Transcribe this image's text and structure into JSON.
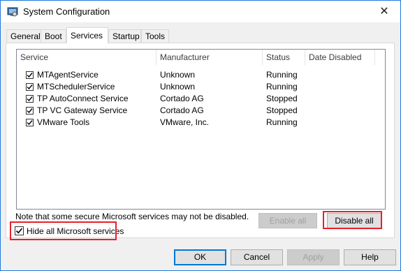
{
  "window": {
    "title": "System Configuration",
    "close_glyph": "✕"
  },
  "tabs": [
    {
      "label": "General",
      "active": false
    },
    {
      "label": "Boot",
      "active": false
    },
    {
      "label": "Services",
      "active": true
    },
    {
      "label": "Startup",
      "active": false
    },
    {
      "label": "Tools",
      "active": false
    }
  ],
  "table": {
    "columns": [
      "Service",
      "Manufacturer",
      "Status",
      "Date Disabled"
    ],
    "rows": [
      {
        "checked": true,
        "service": "MTAgentService",
        "manufacturer": "Unknown",
        "status": "Running",
        "date_disabled": ""
      },
      {
        "checked": true,
        "service": "MTSchedulerService",
        "manufacturer": "Unknown",
        "status": "Running",
        "date_disabled": ""
      },
      {
        "checked": true,
        "service": "TP AutoConnect Service",
        "manufacturer": "Cortado AG",
        "status": "Stopped",
        "date_disabled": ""
      },
      {
        "checked": true,
        "service": "TP VC Gateway Service",
        "manufacturer": "Cortado AG",
        "status": "Stopped",
        "date_disabled": ""
      },
      {
        "checked": true,
        "service": "VMware Tools",
        "manufacturer": "VMware, Inc.",
        "status": "Running",
        "date_disabled": ""
      }
    ]
  },
  "note": "Note that some secure Microsoft services may not be disabled.",
  "buttons": {
    "enable_all": "Enable all",
    "disable_all": "Disable all",
    "ok": "OK",
    "cancel": "Cancel",
    "apply": "Apply",
    "help": "Help"
  },
  "hide_ms": {
    "label": "Hide all Microsoft services",
    "checked": true
  },
  "colors": {
    "highlight": "#e8202a",
    "accent": "#0078d7"
  },
  "icons": {
    "app": "system-configuration-icon",
    "close": "close-icon",
    "check": "checkmark-icon"
  }
}
